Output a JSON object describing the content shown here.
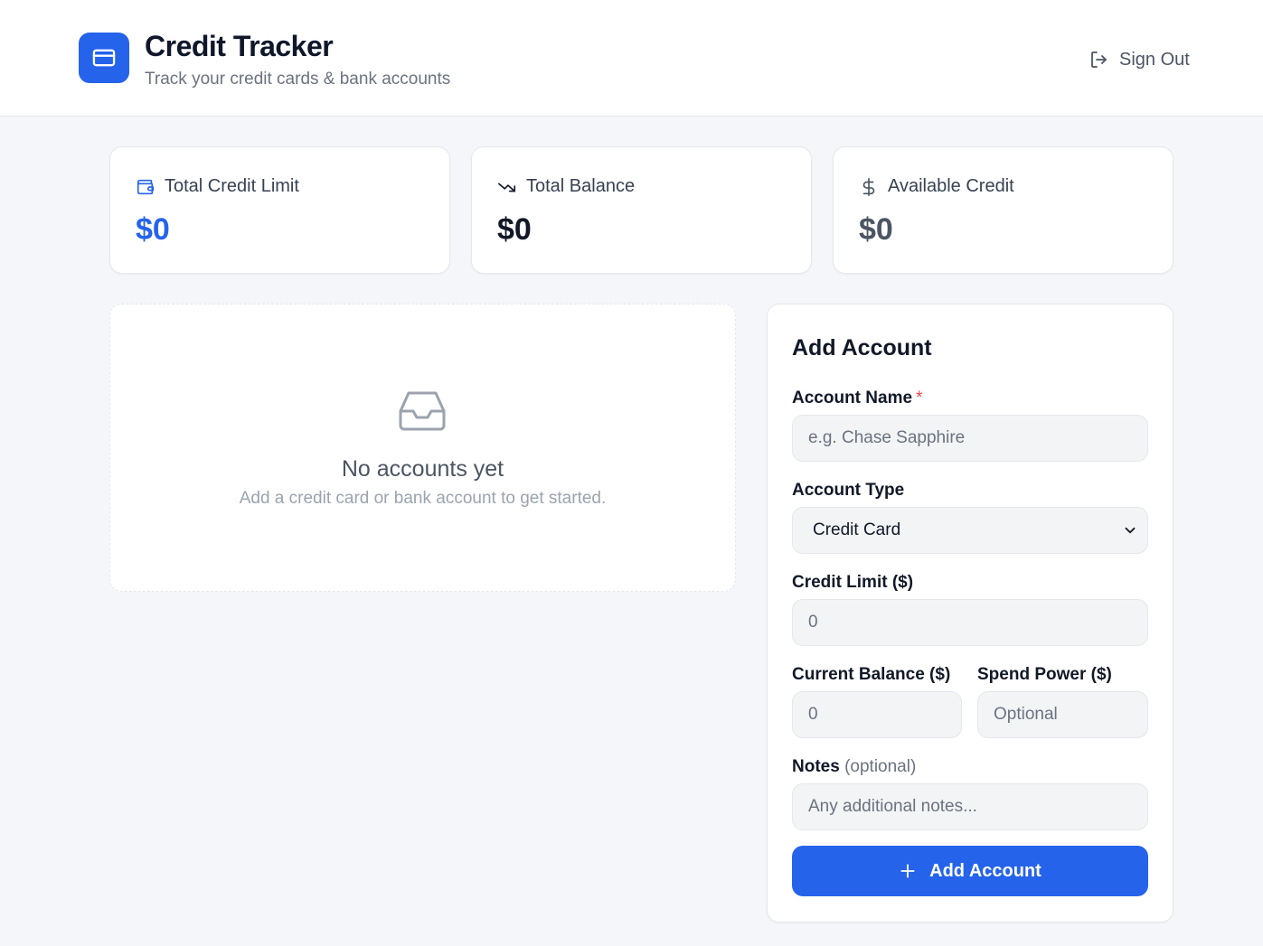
{
  "header": {
    "title": "Credit Tracker",
    "subtitle": "Track your credit cards & bank accounts",
    "sign_out_label": "Sign Out",
    "brand_color": "#2563eb"
  },
  "stats": [
    {
      "label": "Total Credit Limit",
      "value": "$0",
      "icon": "wallet-icon",
      "value_color": "#2563eb"
    },
    {
      "label": "Total Balance",
      "value": "$0",
      "icon": "trending-down-icon",
      "value_color": "#111827"
    },
    {
      "label": "Available Credit",
      "value": "$0",
      "icon": "dollar-icon",
      "value_color": "#4b5563"
    }
  ],
  "empty_state": {
    "icon": "inbox-icon",
    "title": "No accounts yet",
    "subtitle": "Add a credit card or bank account to get started."
  },
  "form": {
    "title": "Add Account",
    "account_name": {
      "label": "Account Name",
      "required_mark": "*",
      "placeholder": "e.g. Chase Sapphire",
      "value": ""
    },
    "account_type": {
      "label": "Account Type",
      "selected": "Credit Card"
    },
    "credit_limit": {
      "label": "Credit Limit ($)",
      "placeholder": "0",
      "value": ""
    },
    "current_balance": {
      "label": "Current Balance ($)",
      "placeholder": "0",
      "value": ""
    },
    "spend_power": {
      "label": "Spend Power ($)",
      "placeholder": "Optional",
      "value": ""
    },
    "notes": {
      "label": "Notes",
      "label_suffix": "(optional)",
      "placeholder": "Any additional notes...",
      "value": ""
    },
    "submit_label": "Add Account"
  }
}
